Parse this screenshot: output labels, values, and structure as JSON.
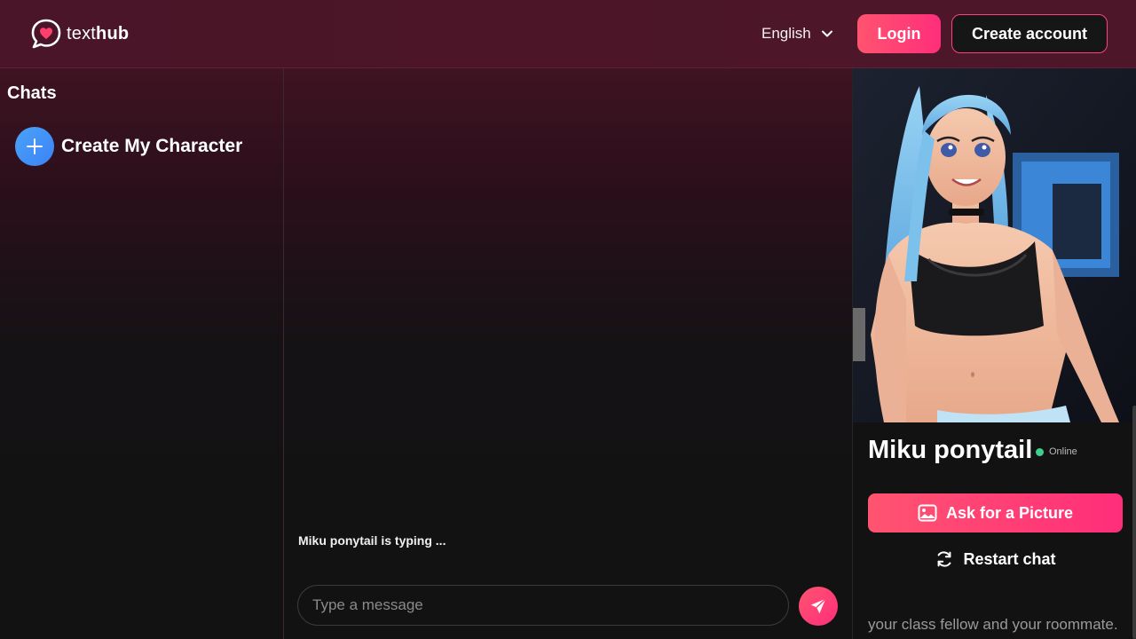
{
  "brand": {
    "name_light": "text",
    "name_bold": "hub",
    "accent": "#ff2e7a"
  },
  "header": {
    "language": "English",
    "login_label": "Login",
    "create_account_label": "Create account"
  },
  "sidebar": {
    "title": "Chats",
    "create_character_label": "Create My Character"
  },
  "chat": {
    "typing_text": "Miku ponytail is typing ...",
    "input_placeholder": "Type a message"
  },
  "character": {
    "name": "Miku ponytail",
    "status": "Online",
    "status_color": "#3ecf8e",
    "ask_picture_label": "Ask for a Picture",
    "restart_label": "Restart chat",
    "description": "your class fellow and your roommate."
  },
  "icons": {
    "logo": "chat-heart-icon",
    "language": "chevron-down-icon",
    "create": "plus-icon",
    "send": "send-icon",
    "picture": "image-icon",
    "restart": "refresh-icon"
  }
}
